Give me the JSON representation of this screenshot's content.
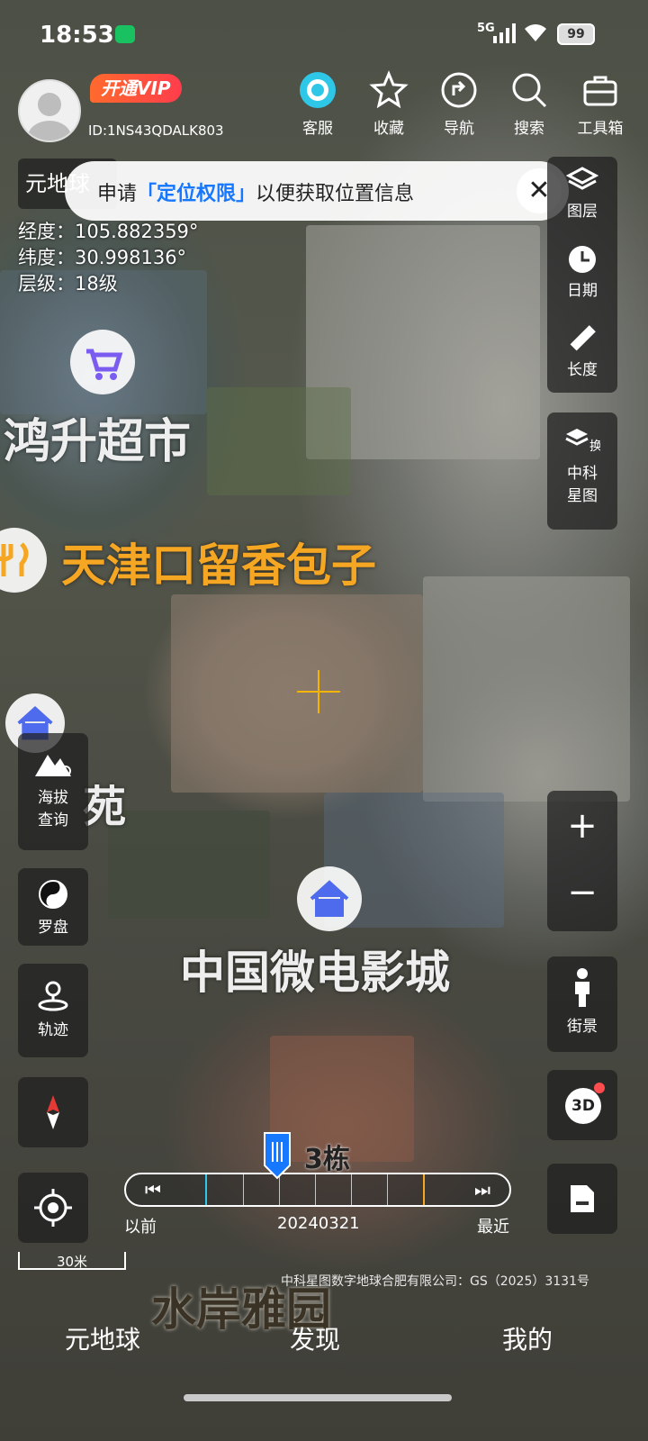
{
  "status_bar": {
    "time": "18:53",
    "signal": "5G",
    "battery": "99"
  },
  "profile": {
    "vip_label": "开通VIP",
    "user_id": "ID:1NS43QDALK803"
  },
  "top_toolbar": [
    {
      "label": "客服",
      "icon": "customer-service-icon"
    },
    {
      "label": "收藏",
      "icon": "star-icon"
    },
    {
      "label": "导航",
      "icon": "navigation-icon"
    },
    {
      "label": "搜索",
      "icon": "search-icon"
    },
    {
      "label": "工具箱",
      "icon": "toolbox-icon"
    }
  ],
  "app_title": "元地球",
  "permission_banner": {
    "prefix": "申请",
    "highlight": "「定位权限」",
    "suffix": "以便获取位置信息",
    "close": "✕"
  },
  "coords": {
    "lon": "经度：105.882359°",
    "lat": "纬度：30.998136°",
    "level": "层级：18级"
  },
  "right_tools": [
    {
      "label": "图层",
      "icon": "layers-icon"
    },
    {
      "label": "日期",
      "icon": "history-icon"
    },
    {
      "label": "长度",
      "icon": "ruler-icon"
    }
  ],
  "map_switch": {
    "label1": "中科",
    "label2": "星图",
    "badge": "换"
  },
  "places": {
    "supermarket": "鸿升超市",
    "restaurant": "天津口留香包子",
    "cinema": "中国微电影城",
    "complex": "水岸雅园",
    "building": "3栋",
    "partial": "苑"
  },
  "left_tools": [
    {
      "label1": "海拔",
      "label2": "查询"
    },
    {
      "label1": "罗盘"
    },
    {
      "label1": "轨迹"
    }
  ],
  "zoom": {
    "plus": "+",
    "minus": "−"
  },
  "street_view": "街景",
  "three_d": "3D",
  "timeline": {
    "earlier": "以前",
    "latest": "最近",
    "date": "20240321",
    "prev": "⏮",
    "next": "⏭"
  },
  "scale_label": "30米",
  "credit": "中科星图数字地球合肥有限公司：GS（2025）3131号",
  "bottom_nav": {
    "home": "元地球",
    "discover": "发现",
    "mine": "我的"
  },
  "colors": {
    "accent": "#1677ff",
    "vip": "#ff4d4f",
    "place_food": "#f5a623",
    "place_blue": "#4f6bed",
    "poi_purple": "#7b5cf0"
  }
}
